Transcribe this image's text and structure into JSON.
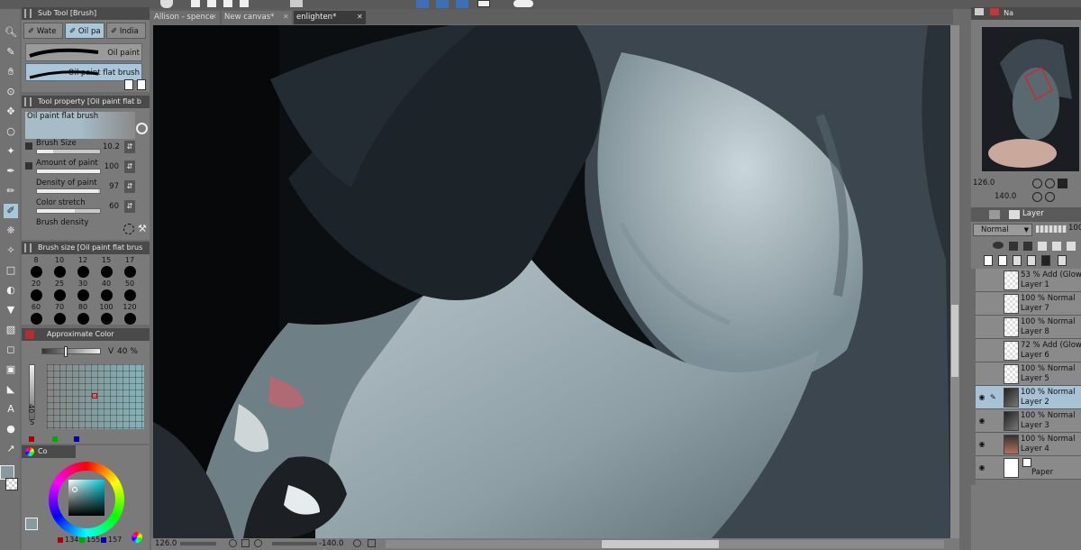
{
  "doc_tabs": [
    {
      "label": "Allison - spence",
      "active": false
    },
    {
      "label": "New canvas*",
      "active": false
    },
    {
      "label": "enlighten*",
      "active": true
    }
  ],
  "subtool": {
    "header": "Sub Tool [Brush]",
    "tabs": [
      "Wate",
      "Oil pa",
      "India"
    ],
    "brushes": [
      "Oil paint",
      "Oil paint flat brush"
    ]
  },
  "tool_property": {
    "header": "Tool property [Oil paint flat b",
    "preview_label": "Oil paint flat brush",
    "rows": [
      {
        "label": "Brush Size",
        "value": "10.2",
        "fill": 0.25
      },
      {
        "label": "Amount of paint",
        "value": "100",
        "fill": 1.0
      },
      {
        "label": "Density of paint",
        "value": "97",
        "fill": 0.97
      },
      {
        "label": "Color stretch",
        "value": "60",
        "fill": 0.6
      },
      {
        "label": "Brush density",
        "value": "",
        "fill": 0.0
      }
    ]
  },
  "brush_size": {
    "header": "Brush size [Oil paint flat brus",
    "sizes": [
      "8",
      "10",
      "12",
      "15",
      "17",
      "20",
      "25",
      "30",
      "40",
      "50",
      "60",
      "70",
      "80",
      "100",
      "120"
    ]
  },
  "approx_color": {
    "header": "Approximate Color",
    "v_label": "V",
    "v_value": "40 %",
    "side_label": "40",
    "side_s": "S"
  },
  "color_wheel": {
    "tab_label": "Co",
    "r": "134",
    "g": "155",
    "b": "157",
    "current_color": "#869b9d"
  },
  "navigator": {
    "tab": "Na",
    "zoom": "126.0",
    "angle": "140.0"
  },
  "layer_panel": {
    "tab": "Layer",
    "blend_mode": "Normal",
    "opacity_short": "100",
    "layers": [
      {
        "mode": "53 % Add (Glow)",
        "name": "Layer 1",
        "visible": false,
        "selected": false,
        "thumb": "blank"
      },
      {
        "mode": "100 % Normal",
        "name": "Layer 7",
        "visible": false,
        "selected": false,
        "thumb": "blank"
      },
      {
        "mode": "100 % Normal",
        "name": "Layer 8",
        "visible": false,
        "selected": false,
        "thumb": "blank"
      },
      {
        "mode": "72 % Add (Glow)",
        "name": "Layer 6",
        "visible": false,
        "selected": false,
        "thumb": "blank"
      },
      {
        "mode": "100 % Normal",
        "name": "Layer 5",
        "visible": false,
        "selected": false,
        "thumb": "blank"
      },
      {
        "mode": "100 % Normal",
        "name": "Layer 2",
        "visible": true,
        "selected": true,
        "thumb": "dark"
      },
      {
        "mode": "100 % Normal",
        "name": "Layer 3",
        "visible": true,
        "selected": false,
        "thumb": "dark"
      },
      {
        "mode": "100 % Normal",
        "name": "Layer 4",
        "visible": true,
        "selected": false,
        "thumb": "color"
      },
      {
        "mode": "",
        "name": "Paper",
        "visible": true,
        "selected": false,
        "thumb": "paper"
      }
    ]
  },
  "status_bar": {
    "zoom": "126.0",
    "angle": "-140.0"
  },
  "colors": {
    "accent": "#a9c7d8",
    "panel": "#7a7a7a",
    "header": "#4a4a4a"
  }
}
